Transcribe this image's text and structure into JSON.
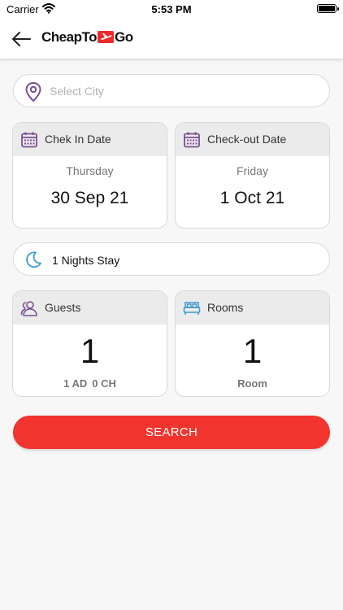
{
  "status_bar": {
    "carrier": "Carrier",
    "time": "5:53 PM"
  },
  "header": {
    "logo_prefix": "CheapTo",
    "logo_suffix": "Go"
  },
  "city": {
    "placeholder": "Select City",
    "value": ""
  },
  "check_in": {
    "title": "Chek In Date",
    "weekday": "Thursday",
    "date": "30 Sep 21"
  },
  "check_out": {
    "title": "Check-out Date",
    "weekday": "Friday",
    "date": "1 Oct 21"
  },
  "stay": {
    "label": "1 Nights Stay"
  },
  "guests": {
    "title": "Guests",
    "count": "1",
    "adults": "1 AD",
    "children": "0 CH"
  },
  "rooms": {
    "title": "Rooms",
    "count": "1",
    "unit": "Room"
  },
  "search": {
    "label": "SEARCH"
  },
  "colors": {
    "accent_purple": "#7a4f93",
    "moon_blue": "#3d9ad1",
    "search_red": "#f2342f"
  },
  "icons": [
    "wifi-icon",
    "battery-icon",
    "back-arrow-icon",
    "plane-icon",
    "location-pin-icon",
    "calendar-icon",
    "moon-icon",
    "users-icon",
    "bed-icon"
  ]
}
